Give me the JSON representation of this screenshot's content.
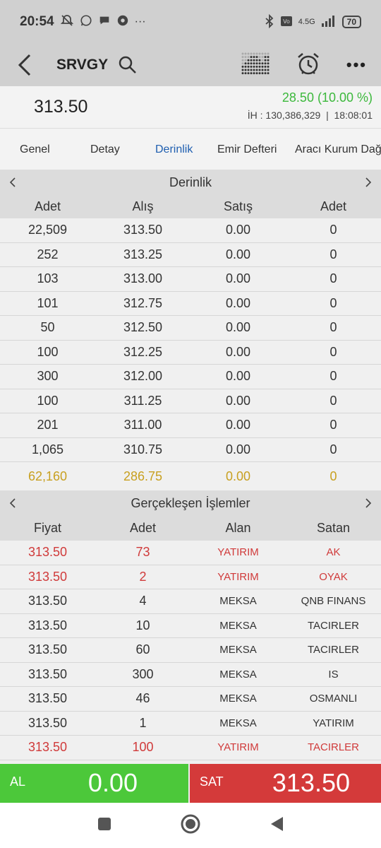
{
  "statusbar": {
    "time": "20:54",
    "more": "···",
    "network": "4.5G",
    "battery": "70"
  },
  "appbar": {
    "symbol": "SRVGY",
    "more": "•••"
  },
  "quote": {
    "price": "313.50",
    "change": "28.50 (10.00 %)",
    "ih": "İH : 130,386,329",
    "separator": "|",
    "time": "18:08:01"
  },
  "tabs": [
    {
      "label": "Genel"
    },
    {
      "label": "Detay"
    },
    {
      "label": "Derinlik"
    },
    {
      "label": "Emir Defteri"
    },
    {
      "label": "Aracı Kurum Dağ"
    }
  ],
  "depth": {
    "title": "Derinlik",
    "columns": [
      "Adet",
      "Alış",
      "Satış",
      "Adet"
    ],
    "rows": [
      [
        "22,509",
        "313.50",
        "0.00",
        "0"
      ],
      [
        "252",
        "313.25",
        "0.00",
        "0"
      ],
      [
        "103",
        "313.00",
        "0.00",
        "0"
      ],
      [
        "101",
        "312.75",
        "0.00",
        "0"
      ],
      [
        "50",
        "312.50",
        "0.00",
        "0"
      ],
      [
        "100",
        "312.25",
        "0.00",
        "0"
      ],
      [
        "300",
        "312.00",
        "0.00",
        "0"
      ],
      [
        "100",
        "311.25",
        "0.00",
        "0"
      ],
      [
        "201",
        "311.00",
        "0.00",
        "0"
      ],
      [
        "1,065",
        "310.75",
        "0.00",
        "0"
      ]
    ],
    "total": [
      "62,160",
      "286.75",
      "0.00",
      "0"
    ]
  },
  "trades": {
    "title": "Gerçekleşen İşlemler",
    "columns": [
      "Fiyat",
      "Adet",
      "Alan",
      "Satan"
    ],
    "rows": [
      {
        "cells": [
          "313.50",
          "73",
          "YATIRIM",
          "AK"
        ],
        "red": true
      },
      {
        "cells": [
          "313.50",
          "2",
          "YATIRIM",
          "OYAK"
        ],
        "red": true
      },
      {
        "cells": [
          "313.50",
          "4",
          "MEKSA",
          "QNB FINANS"
        ],
        "red": false
      },
      {
        "cells": [
          "313.50",
          "10",
          "MEKSA",
          "TACIRLER"
        ],
        "red": false
      },
      {
        "cells": [
          "313.50",
          "60",
          "MEKSA",
          "TACIRLER"
        ],
        "red": false
      },
      {
        "cells": [
          "313.50",
          "300",
          "MEKSA",
          "IS"
        ],
        "red": false
      },
      {
        "cells": [
          "313.50",
          "46",
          "MEKSA",
          "OSMANLI"
        ],
        "red": false
      },
      {
        "cells": [
          "313.50",
          "1",
          "MEKSA",
          "YATIRIM"
        ],
        "red": false
      },
      {
        "cells": [
          "313.50",
          "100",
          "YATIRIM",
          "TACIRLER"
        ],
        "red": true
      }
    ]
  },
  "actions": {
    "buy_label": "AL",
    "buy_value": "0.00",
    "sell_label": "SAT",
    "sell_value": "313.50"
  },
  "colors": {
    "up": "#3cb83c",
    "down": "#d03a3a",
    "buy": "#4cc83a",
    "sell": "#d43a3a",
    "active_tab": "#1f5fb0",
    "total": "#c8a020"
  }
}
